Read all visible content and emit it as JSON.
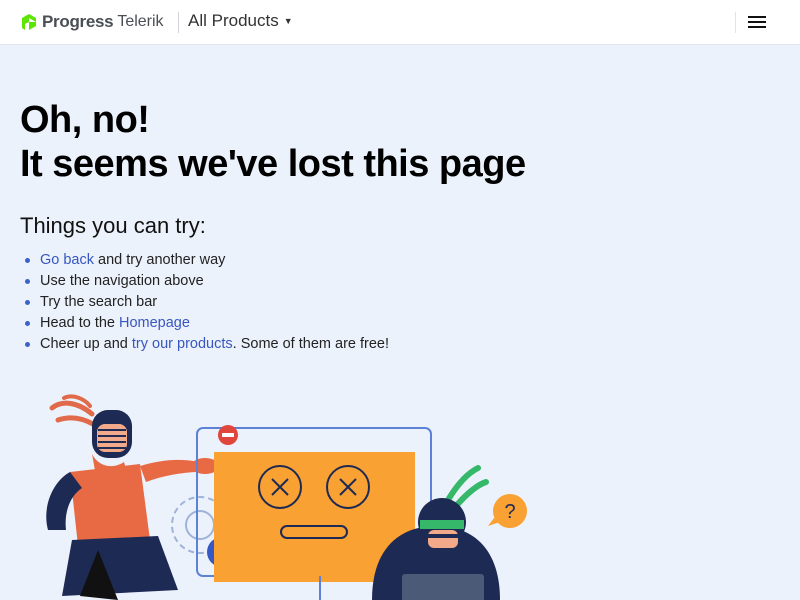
{
  "header": {
    "brand_primary": "Progress",
    "brand_secondary": "Telerik",
    "products_label": "All Products",
    "brand_color": "#5ce500"
  },
  "content": {
    "headline_line1": "Oh, no!",
    "headline_line2": "It seems we've lost this page",
    "subheading": "Things you can try:",
    "tips": [
      {
        "link": "Go back",
        "after": " and try another way"
      },
      {
        "text": "Use the navigation above"
      },
      {
        "text": "Try the search bar"
      },
      {
        "before": "Head to the ",
        "link": "Homepage"
      },
      {
        "before": "Cheer up and ",
        "link": "try our products",
        "after": ". Some of them are free!"
      }
    ],
    "link_color": "#3856c0"
  },
  "illustration": {
    "screen_color": "#f9a233",
    "question_mark": "?"
  }
}
